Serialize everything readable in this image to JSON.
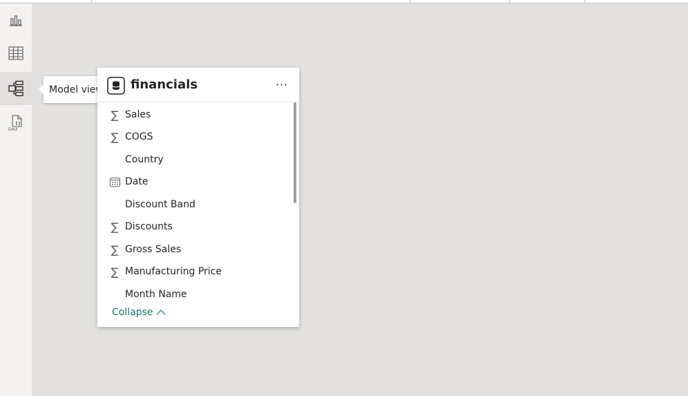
{
  "tooltip": {
    "text": "Model view"
  },
  "rail": {
    "items": [
      {
        "name": "report-view",
        "icon": "bar-chart-icon"
      },
      {
        "name": "table-view",
        "icon": "table-grid-icon"
      },
      {
        "name": "model-view",
        "icon": "model-diagram-icon",
        "active": true
      },
      {
        "name": "dax-query-view",
        "icon": "dax-file-icon"
      }
    ]
  },
  "table_card": {
    "title": "financials",
    "more_label": "···",
    "fields": [
      {
        "label": "Sales",
        "icon": "sigma-icon"
      },
      {
        "label": "COGS",
        "icon": "sigma-icon"
      },
      {
        "label": "Country",
        "icon": ""
      },
      {
        "label": "Date",
        "icon": "calendar-icon"
      },
      {
        "label": "Discount Band",
        "icon": ""
      },
      {
        "label": "Discounts",
        "icon": "sigma-icon"
      },
      {
        "label": "Gross Sales",
        "icon": "sigma-icon"
      },
      {
        "label": "Manufacturing Price",
        "icon": "sigma-icon"
      },
      {
        "label": "Month Name",
        "icon": ""
      }
    ],
    "collapse_label": "Collapse"
  },
  "colors": {
    "accent": "#117865",
    "canvas": "#e2e1df",
    "rail": "#f3f2f1"
  }
}
